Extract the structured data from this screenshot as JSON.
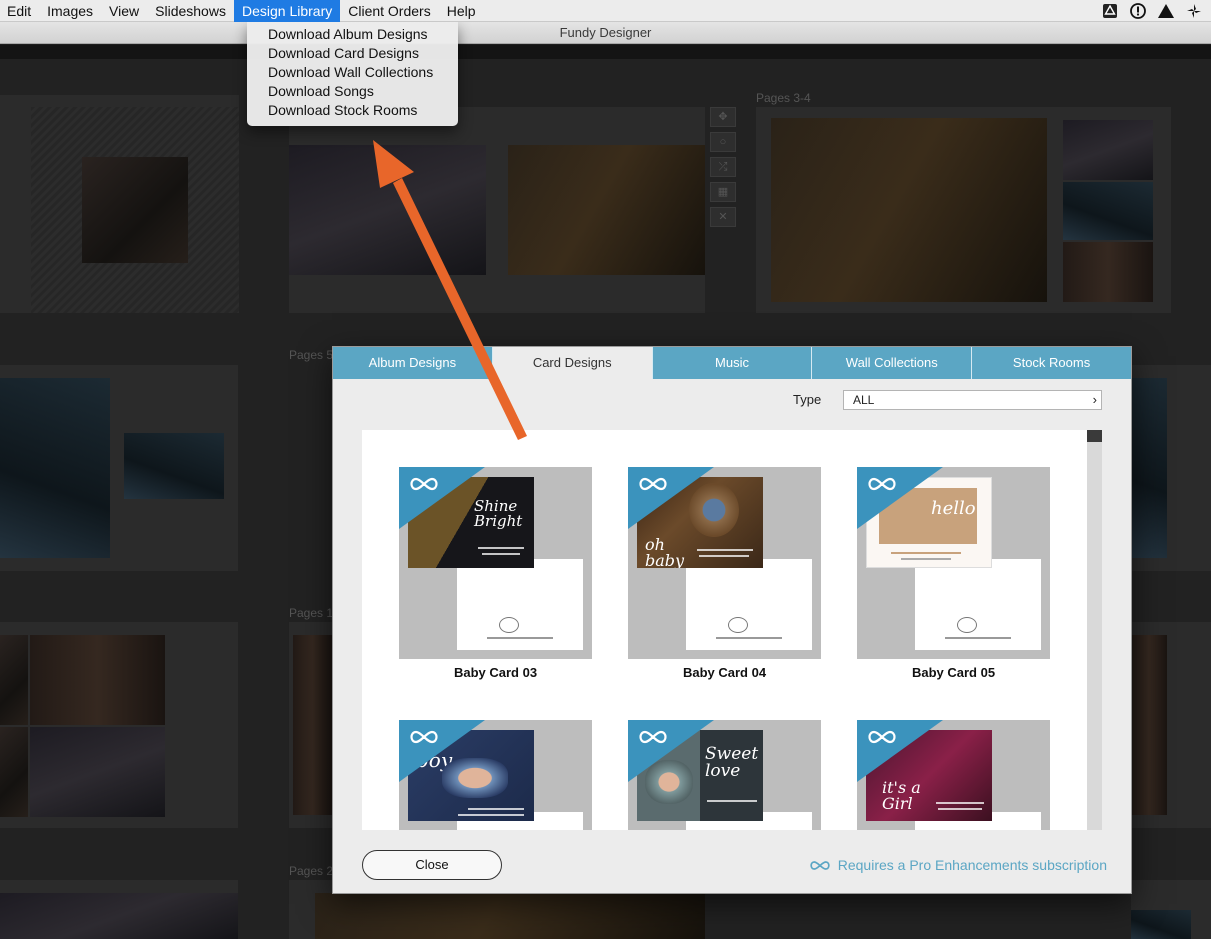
{
  "menubar": {
    "items": [
      "Edit",
      "Images",
      "View",
      "Slideshows",
      "Design Library",
      "Client Orders",
      "Help"
    ],
    "active": "Design Library",
    "status_icons": [
      "drive-icon",
      "password-icon",
      "vpn-icon",
      "pinwheel-icon"
    ]
  },
  "window": {
    "title": "Fundy Designer"
  },
  "dropdown": {
    "items": [
      "Download Album Designs",
      "Download Card Designs",
      "Download Wall Collections",
      "Download Songs",
      "Download Stock Rooms"
    ]
  },
  "background": {
    "page_labels": [
      "Pages 3-4",
      "Pages 5",
      "Pages 1",
      "Pages 2"
    ]
  },
  "dialog": {
    "tabs": [
      "Album Designs",
      "Card Designs",
      "Music",
      "Wall Collections",
      "Stock Rooms"
    ],
    "active_tab": "Card Designs",
    "type_label": "Type",
    "type_value": "ALL",
    "cards": [
      {
        "label": "Baby Card 03",
        "front_text": "Shine Bright"
      },
      {
        "label": "Baby Card 04",
        "front_text": "oh baby"
      },
      {
        "label": "Baby Card 05",
        "front_text": "hello"
      },
      {
        "label": "",
        "front_text": "boy"
      },
      {
        "label": "",
        "front_text": "Sweet love"
      },
      {
        "label": "",
        "front_text": "it's a Girl"
      }
    ],
    "close_label": "Close",
    "pro_note": "Requires a Pro Enhancements subscription"
  },
  "colors": {
    "accent": "#5ba6c4",
    "menu_highlight": "#1f7be3",
    "arrow": "#e8662a"
  }
}
